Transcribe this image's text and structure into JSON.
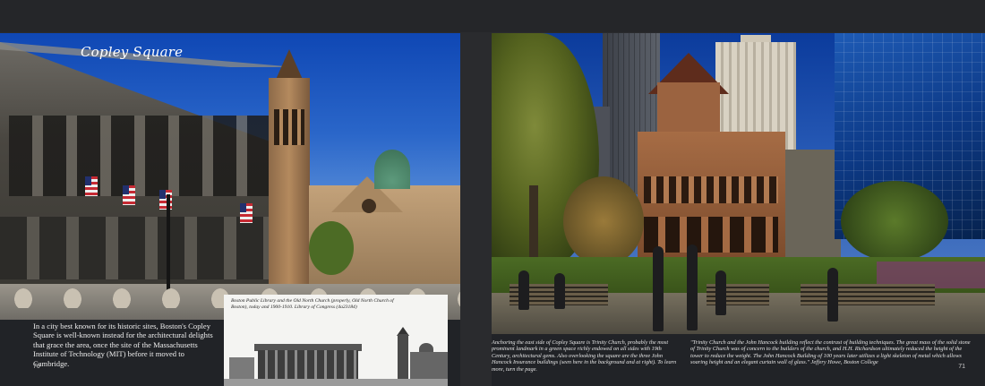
{
  "spread": {
    "left_page": {
      "photo_title": "Copley Square",
      "body_text": "In a city best known for its historic sites, Boston's Copley Square is well-known instead for the architectural delights that grace the area, once the site of the Massachusetts Institute of Technology (MIT) before it moved to Cambridge.",
      "page_number": "70",
      "inset_caption": "Boston Public Library and the Old North Church (properly, Old North Church of Boston), today and 1900-1910.  Library of Congress (4a23184)"
    },
    "right_page": {
      "caption_left": "Anchoring the east side of Copley Square is Trinity Church, probably the most prominent landmark in a green space richly endowed on all sides with 19th Century, architectural gems. Also overlooking the square are the three John Hancock Insurance buildings (seen here in the background and at right). To learn more, turn the page.",
      "caption_right": "\"Trinity Church and the John Hancock building reflect the contrast of building techniques. The great mass of the solid stone of Trinity Church was of concern to the builders of the church, and H.H. Richardson ultimately reduced the height of the tower to reduce the weight. The John Hancock Building of 100 years later utilizes a light skeleton of metal which allows soaring height and an elegant curtain wall of glass.\"  Jeffery Howe, Boston College",
      "page_number": "71"
    }
  }
}
